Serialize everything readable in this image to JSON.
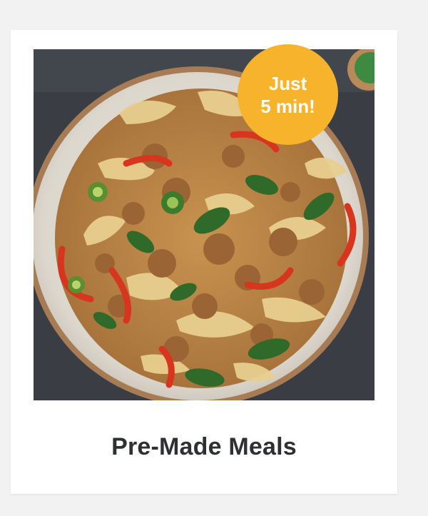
{
  "card": {
    "title": "Pre-Made Meals",
    "badge": {
      "line1": "Just",
      "line2": "5 min!"
    },
    "image_alt": "Stir-fried wide rice noodles with ground meat, peppers and greens in a bowl"
  },
  "colors": {
    "badge": "#f7b32b",
    "title_text": "#2f3033",
    "card_bg": "#ffffff",
    "page_bg": "#f2f2f2"
  }
}
